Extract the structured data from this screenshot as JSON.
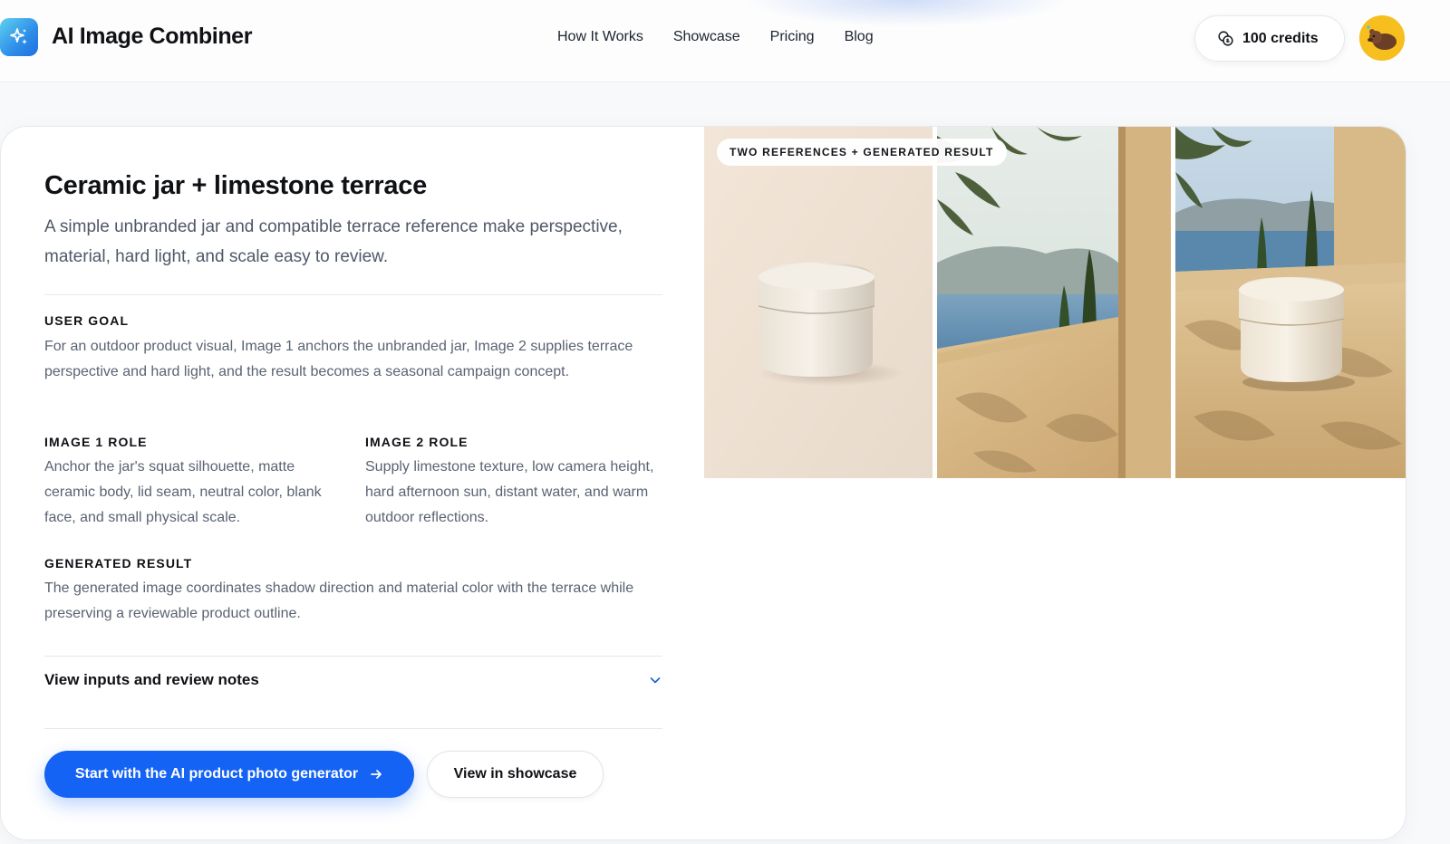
{
  "header": {
    "brand": "AI Image Combiner",
    "nav": [
      "How It Works",
      "Showcase",
      "Pricing",
      "Blog"
    ],
    "credits": "100 credits",
    "icons": {
      "logo": "sparkle-icon",
      "credits": "coins-icon",
      "avatar": "avatar-image"
    }
  },
  "card": {
    "title": "Ceramic jar + limestone terrace",
    "subtitle": "A simple unbranded jar and compatible terrace reference make perspective, material, hard light, and scale easy to review.",
    "user_goal": {
      "label": "USER GOAL",
      "text": "For an outdoor product visual, Image 1 anchors the unbranded jar, Image 2 supplies terrace perspective and hard light, and the result becomes a seasonal campaign concept."
    },
    "image1_role": {
      "label": "IMAGE 1 ROLE",
      "text": "Anchor the jar's squat silhouette, matte ceramic body, lid seam, neutral color, blank face, and small physical scale."
    },
    "image2_role": {
      "label": "IMAGE 2 ROLE",
      "text": "Supply limestone texture, low camera height, hard afternoon sun, distant water, and warm outdoor reflections."
    },
    "generated_result": {
      "label": "GENERATED RESULT",
      "text": "The generated image coordinates shadow direction and material color with the terrace while preserving a reviewable product outline."
    },
    "accordion_label": "View inputs and review notes",
    "primary_button": "Start with the AI product photo generator",
    "secondary_button": "View in showcase",
    "image_badge": "TWO REFERENCES + GENERATED RESULT"
  },
  "colors": {
    "accent": "#1463f4",
    "avatar_bg": "#f6bf1e",
    "text_primary": "#0f1115",
    "text_muted": "#5a6373"
  }
}
